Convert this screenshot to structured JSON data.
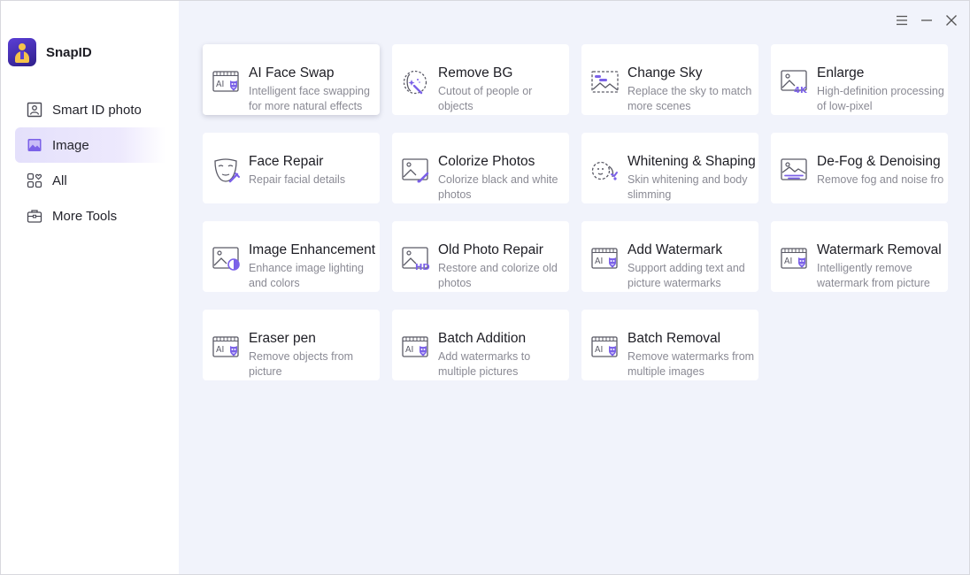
{
  "app": {
    "name": "SnapID"
  },
  "sidebar": {
    "items": [
      {
        "label": "Smart ID photo",
        "icon": "id-photo-icon",
        "active": false
      },
      {
        "label": "Image",
        "icon": "image-icon",
        "active": true
      },
      {
        "label": "All",
        "icon": "grid-heart-icon",
        "active": false
      },
      {
        "label": "More Tools",
        "icon": "toolbox-icon",
        "active": false
      }
    ]
  },
  "window_controls": [
    "menu-icon",
    "minimize-icon",
    "close-icon"
  ],
  "colors": {
    "accent": "#7b61e8",
    "icon_stroke": "#5a5a66",
    "background": "#f1f3fb"
  },
  "tools": [
    {
      "title": "AI Face Swap",
      "desc": "Intelligent face swapping for more natural effects",
      "icon": "ai-face-swap-icon"
    },
    {
      "title": "Remove BG",
      "desc": "Cutout of people or objects",
      "icon": "remove-bg-icon"
    },
    {
      "title": "Change Sky",
      "desc": "Replace the sky to match more scenes",
      "icon": "change-sky-icon"
    },
    {
      "title": "Enlarge",
      "desc": "High-definition processing of low-pixel",
      "icon": "enlarge-4k-icon"
    },
    {
      "title": "Face Repair",
      "desc": "Repair facial details",
      "icon": "face-repair-icon"
    },
    {
      "title": "Colorize Photos",
      "desc": "Colorize black and white photos",
      "icon": "colorize-icon"
    },
    {
      "title": "Whitening & Shaping",
      "desc": "Skin whitening and body slimming",
      "icon": "whitening-icon"
    },
    {
      "title": "De-Fog & Denoising",
      "desc": "Remove fog and noise fro",
      "icon": "defog-icon"
    },
    {
      "title": "Image Enhancement",
      "desc": "Enhance image lighting and colors",
      "icon": "enhance-icon"
    },
    {
      "title": "Old Photo Repair",
      "desc": "Restore and colorize old photos",
      "icon": "old-photo-hd-icon"
    },
    {
      "title": "Add Watermark",
      "desc": "Support adding text and picture watermarks",
      "icon": "ai-add-watermark-icon"
    },
    {
      "title": "Watermark Removal",
      "desc": "Intelligently remove watermark from picture",
      "icon": "ai-watermark-removal-icon"
    },
    {
      "title": "Eraser pen",
      "desc": "Remove objects from picture",
      "icon": "ai-eraser-icon"
    },
    {
      "title": "Batch Addition",
      "desc": "Add watermarks to multiple pictures",
      "icon": "ai-batch-addition-icon"
    },
    {
      "title": "Batch Removal",
      "desc": "Remove watermarks from multiple images",
      "icon": "ai-batch-removal-icon"
    }
  ]
}
